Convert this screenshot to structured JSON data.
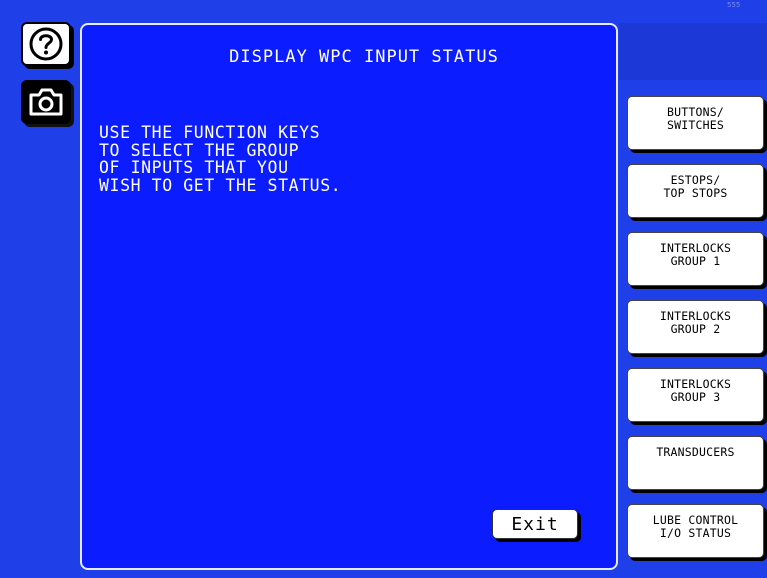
{
  "corner_mark": "555",
  "panel": {
    "title": "DISPLAY WPC INPUT STATUS",
    "instructions": [
      "USE THE FUNCTION KEYS",
      "TO SELECT THE GROUP",
      "OF INPUTS THAT YOU",
      "WISH TO GET THE STATUS."
    ],
    "exit_label": "Exit"
  },
  "function_keys": [
    {
      "line1": "BUTTONS/",
      "line2": "SWITCHES"
    },
    {
      "line1": "ESTOPS/",
      "line2": "TOP STOPS"
    },
    {
      "line1": "INTERLOCKS",
      "line2": "GROUP 1"
    },
    {
      "line1": "INTERLOCKS",
      "line2": "GROUP 2"
    },
    {
      "line1": "INTERLOCKS",
      "line2": "GROUP 3"
    },
    {
      "line1": "TRANSDUCERS",
      "line2": ""
    },
    {
      "line1": "LUBE CONTROL",
      "line2": "I/O STATUS"
    }
  ],
  "icons": {
    "help": "question-mark-circle-icon",
    "camera": "camera-icon"
  },
  "colors": {
    "background": "#1f3fe8",
    "panel": "#0b1dff",
    "button": "#ffffff",
    "text": "#ffffff"
  }
}
